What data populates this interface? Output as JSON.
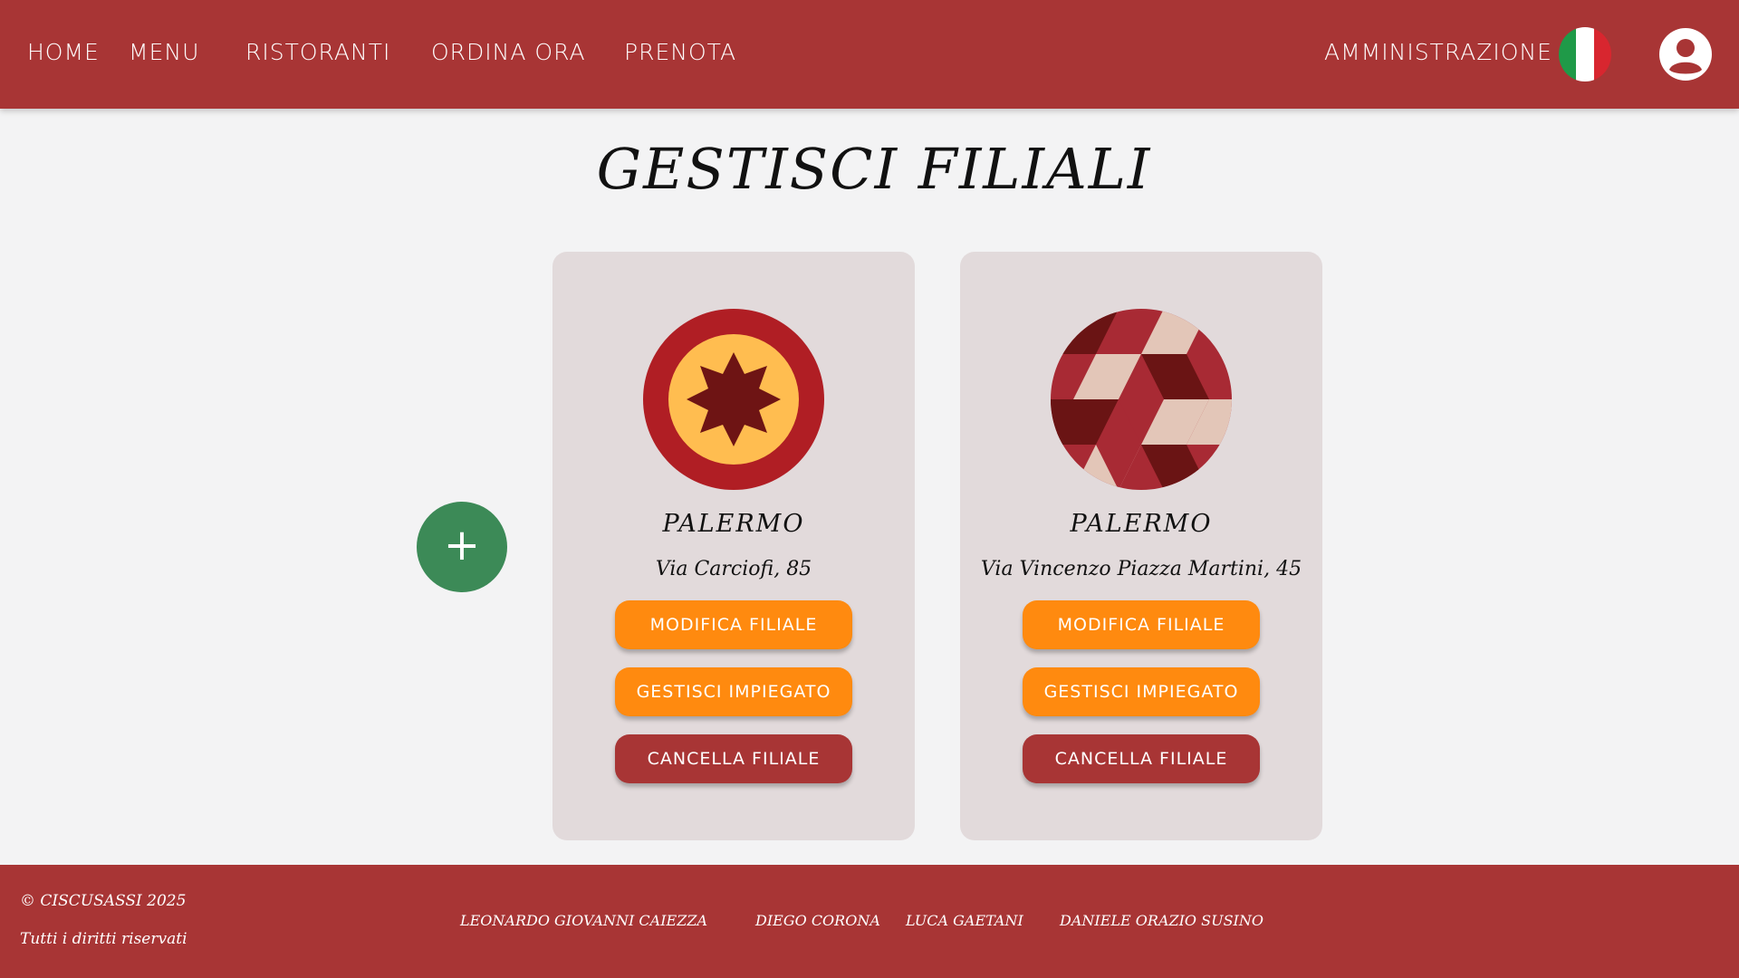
{
  "nav": {
    "links": [
      "HOME",
      "MENU",
      "RISTORANTI",
      "ORDINA ORA",
      "PRENOTA"
    ],
    "admin": "AMMINISTRAZIONE",
    "flag_icon": "italy-flag-icon",
    "user_icon": "user-icon"
  },
  "page": {
    "title": "GESTISCI FILIALI"
  },
  "add_button": {
    "label": "+"
  },
  "cards": [
    {
      "city": "PALERMO",
      "address": "Via Carciofi, 85",
      "logo_icon": "sun-star-logo",
      "buttons": [
        "MODIFICA FILIALE",
        "GESTISCI IMPIEGATO",
        "CANCELLA FILIALE"
      ]
    },
    {
      "city": "PALERMO",
      "address": "Via Vincenzo Piazza Martini, 45",
      "logo_icon": "cube-pattern-logo",
      "buttons": [
        "MODIFICA FILIALE",
        "GESTISCI IMPIEGATO",
        "CANCELLA FILIALE"
      ]
    }
  ],
  "footer": {
    "copyright": "© CISCUSASSI 2025",
    "rights": "Tutti i diritti riservati",
    "authors": [
      "LEONARDO GIOVANNI CAIEZZA",
      "DIEGO CORONA",
      "LUCA GAETANI",
      "DANIELE ORAZIO SUSINO"
    ]
  },
  "colors": {
    "primary_red": "#a83535",
    "orange": "#ff8a0f",
    "green": "#3c8a57",
    "card_bg": "#e2dadb"
  }
}
